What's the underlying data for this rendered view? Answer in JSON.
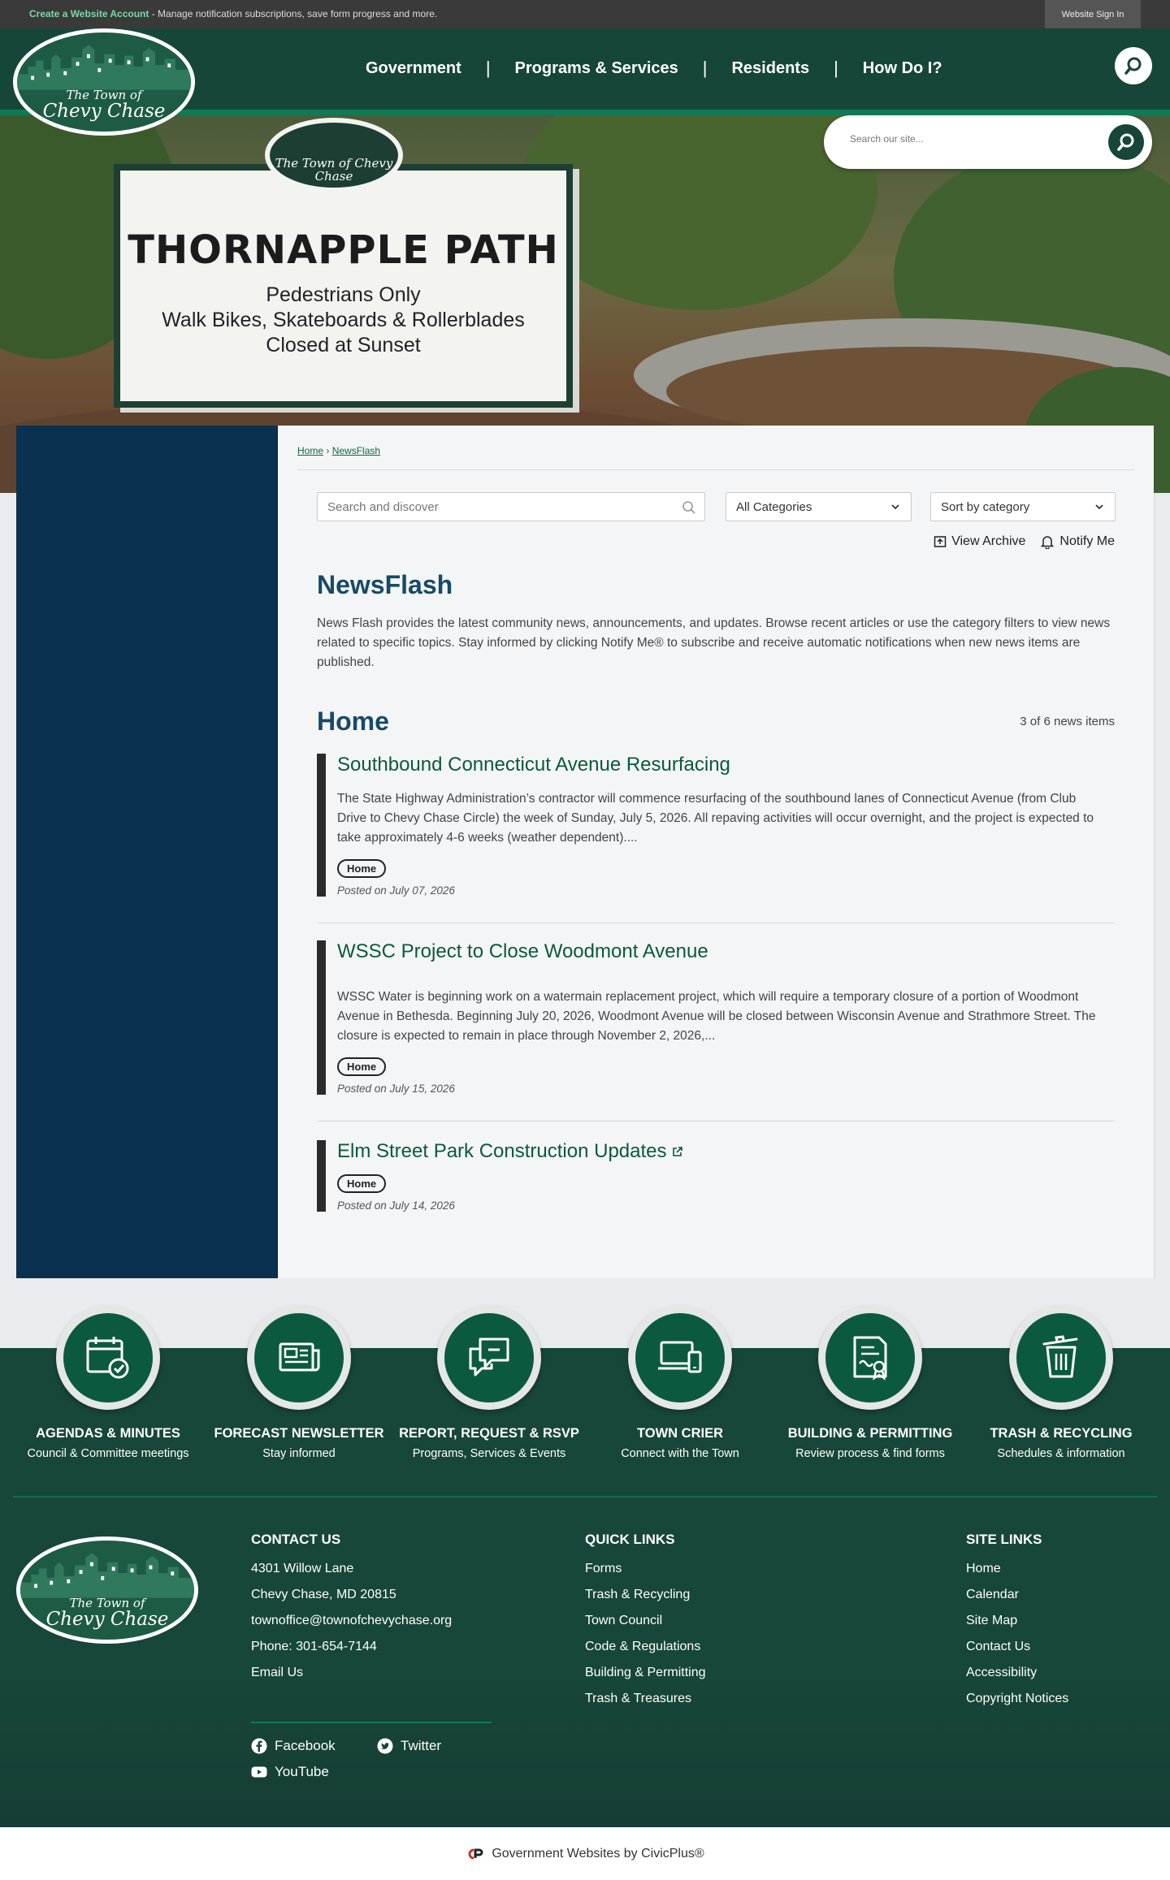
{
  "topbar": {
    "create_account": "Create a Website Account",
    "create_account_desc": " - Manage notification subscriptions, save form progress and more.",
    "sign_in": "Website Sign In"
  },
  "logo": {
    "line1": "The Town of",
    "line2": "Chevy Chase"
  },
  "nav": [
    "Government",
    "Programs & Services",
    "Residents",
    "How Do I?"
  ],
  "hero": {
    "search_placeholder": "Search our site...",
    "sign_badge": "The Town of Chevy Chase",
    "sign_title": "THORNAPPLE PATH",
    "sign_lines": [
      "Pedestrians Only",
      "Walk Bikes, Skateboards & Rollerblades",
      "Closed at Sunset"
    ]
  },
  "breadcrumb": {
    "home": "Home",
    "sep": "›",
    "current": "NewsFlash"
  },
  "filters": {
    "search_placeholder": "Search and discover",
    "category": "All Categories",
    "sort": "Sort by category",
    "view_archive": "View Archive",
    "notify_me": "Notify Me"
  },
  "page": {
    "title": "NewsFlash",
    "description": "News Flash provides the latest community news, announcements, and updates. Browse recent articles or use the category filters to view news related to specific topics. Stay informed by clicking Notify Me® to subscribe and receive automatic notifications when new news items are published.",
    "category_title": "Home",
    "count": "3 of 6 news items"
  },
  "news": [
    {
      "title": "Southbound Connecticut Avenue Resurfacing",
      "body": "The State Highway Administration’s contractor will commence resurfacing of the southbound lanes of Connecticut Avenue (from Club Drive to Chevy Chase Circle) the week of Sunday, July 5, 2026.  All repaving activities will occur overnight, and the project is expected to take approximately 4-6 weeks (weather dependent)....",
      "tag": "Home",
      "date": "Posted on July 07, 2026"
    },
    {
      "title": "WSSC Project to Close Woodmont Avenue",
      "body": "WSSC Water is beginning work on a watermain replacement project, which will require a temporary closure of a portion of Woodmont Avenue in Bethesda. Beginning July 20, 2026, Woodmont Avenue will be closed between Wisconsin Avenue and Strathmore Street. The closure is expected to remain in place through November 2, 2026,...",
      "tag": "Home",
      "date": "Posted on July 15, 2026"
    },
    {
      "title": "Elm Street Park Construction Updates",
      "body": "",
      "tag": "Home",
      "date": "Posted on July 14, 2026"
    }
  ],
  "tiles": [
    {
      "label": "AGENDAS & MINUTES",
      "sub": "Council & Committee meetings",
      "icon": "calendar-check-icon"
    },
    {
      "label": "FORECAST NEWSLETTER",
      "sub": "Stay informed",
      "icon": "newspaper-icon"
    },
    {
      "label": "REPORT, REQUEST & RSVP",
      "sub": "Programs, Services & Events",
      "icon": "chat-bubbles-icon"
    },
    {
      "label": "TOWN CRIER",
      "sub": "Connect with the Town",
      "icon": "devices-icon"
    },
    {
      "label": "BUILDING & PERMITTING",
      "sub": "Review process & find forms",
      "icon": "certificate-icon"
    },
    {
      "label": "TRASH & RECYCLING",
      "sub": "Schedules & information",
      "icon": "trash-bin-icon"
    }
  ],
  "footer": {
    "contact": {
      "heading": "CONTACT US",
      "address1": "4301 Willow Lane",
      "address2": "Chevy Chase, MD 20815",
      "email": "townoffice@townofchevychase.org",
      "phone": "Phone: 301-654-7144",
      "email_us": "Email Us"
    },
    "quick_links": {
      "heading": "QUICK LINKS",
      "items": [
        "Forms",
        "Trash & Recycling",
        "Town Council",
        "Code & Regulations",
        "Building & Permitting",
        "Trash & Treasures"
      ]
    },
    "site_links": {
      "heading": "SITE LINKS",
      "items": [
        "Home",
        "Calendar",
        "Site Map",
        "Contact Us",
        "Accessibility",
        "Copyright Notices"
      ]
    },
    "social": {
      "facebook": "Facebook",
      "twitter": "Twitter",
      "youtube": "YouTube"
    },
    "vendor": "Government Websites by CivicPlus®"
  },
  "colors": {
    "header": "#16463a",
    "accent": "#0f7a54",
    "sidebar": "#0a3150",
    "title": "#184a66",
    "link": "#0a5a3a"
  }
}
